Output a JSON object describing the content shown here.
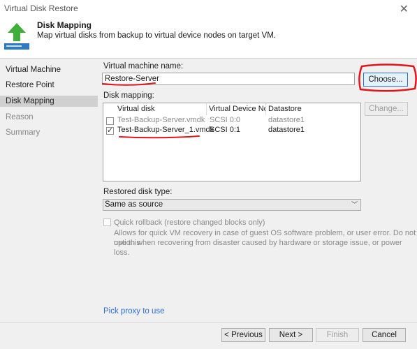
{
  "window": {
    "title": "Virtual Disk Restore"
  },
  "header": {
    "title": "Disk Mapping",
    "description": "Map virtual disks from backup to virtual device nodes on target VM."
  },
  "sidebar": {
    "items": [
      {
        "label": "Virtual Machine"
      },
      {
        "label": "Restore Point"
      },
      {
        "label": "Disk Mapping"
      },
      {
        "label": "Reason"
      },
      {
        "label": "Summary"
      }
    ]
  },
  "vm": {
    "label": "Virtual machine name:",
    "value": "Restore-Server",
    "choose_label": "Choose..."
  },
  "mapping": {
    "label": "Disk mapping:",
    "change_label": "Change...",
    "columns": [
      "Virtual disk",
      "Virtual Device No...",
      "Datastore"
    ],
    "rows": [
      {
        "checked": false,
        "disk": "Test-Backup-Server.vmdk",
        "node": "SCSI 0:0",
        "datastore": "datastore1"
      },
      {
        "checked": true,
        "disk": "Test-Backup-Server_1.vmdk",
        "node": "SCSI 0:1",
        "datastore": "datastore1"
      }
    ]
  },
  "disk_type": {
    "label": "Restored disk type:",
    "value": "Same as source"
  },
  "quick_rollback": {
    "label": "Quick rollback (restore changed blocks only)",
    "description_line1": "Allows for quick VM recovery in case of guest OS software problem, or user error. Do not use this",
    "description_line2": "option when recovering from disaster caused by hardware or storage issue, or power loss."
  },
  "proxy_link": "Pick proxy to use",
  "footer": {
    "previous": "< Previous",
    "next": "Next >",
    "finish": "Finish",
    "cancel": "Cancel"
  },
  "colors": {
    "accent": "#2a6fd6",
    "annotation": "#e0141b",
    "wizard_arrow": "#3fae3a"
  },
  "icons": {
    "wizard": "green-up-arrow-drive-icon",
    "close": "close-icon",
    "dropdown": "chevron-down-icon"
  }
}
